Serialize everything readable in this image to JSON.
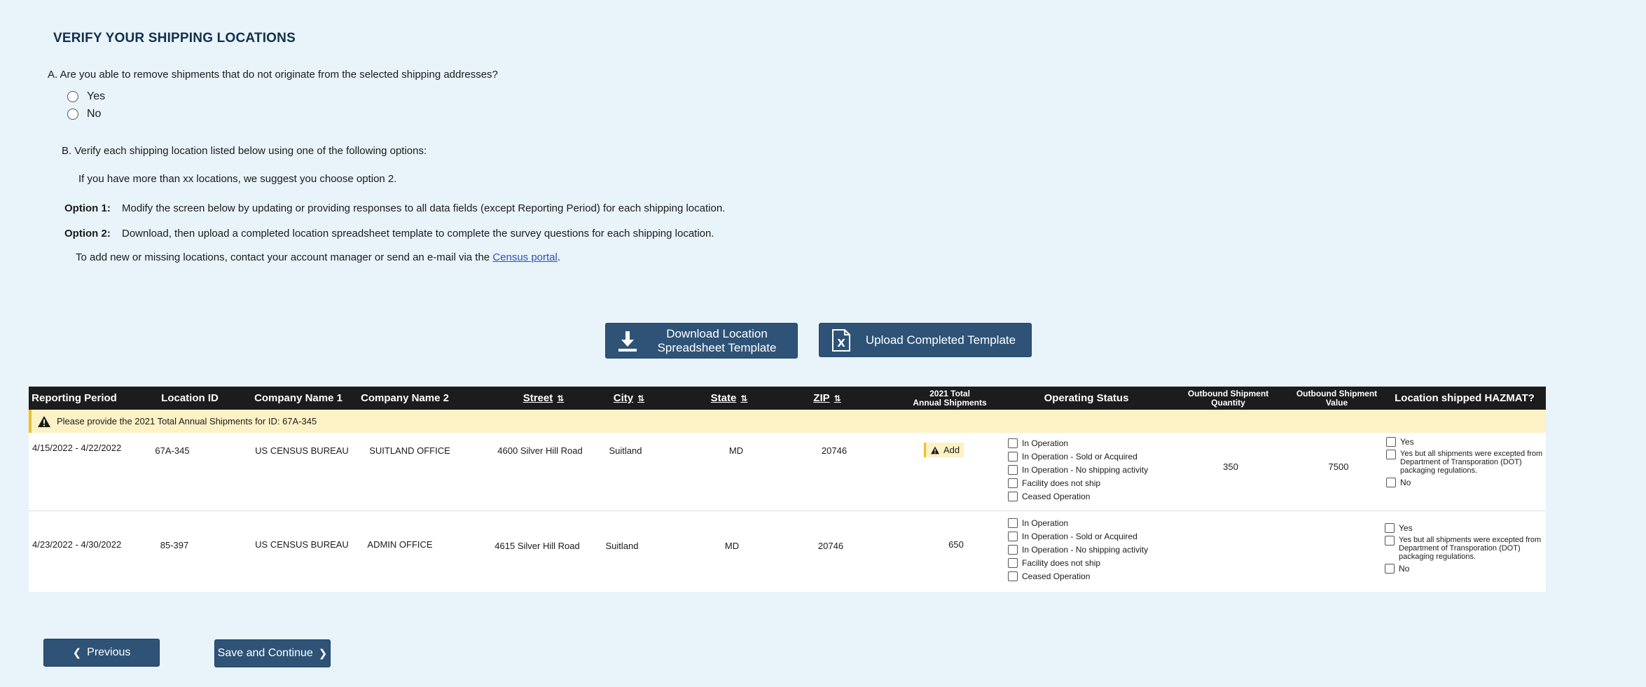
{
  "page": {
    "title": "VERIFY YOUR SHIPPING LOCATIONS"
  },
  "question_a": {
    "text": "A.  Are you able to remove shipments that do not originate from the selected shipping addresses?",
    "options": [
      "Yes",
      "No"
    ]
  },
  "question_b": {
    "text": "B.  Verify each shipping location listed below using one of the following options:",
    "hint": "If you have more than xx locations,  we suggest you choose option 2.",
    "option1_label": "Option 1:",
    "option1_text": "Modify the screen below by updating or providing responses to all data fields (except Reporting Period) for each shipping location.",
    "option2_label": "Option 2:",
    "option2_text": "Download, then upload a completed location spreadsheet template to complete the survey questions for each shipping location.",
    "add_missing_text": "To add new or missing locations,  contact your account manager or send an e-mail via the ",
    "census_link": "Census portal",
    "add_missing_end": "."
  },
  "buttons": {
    "download_line1": "Download Location",
    "download_line2": "Spreadsheet Template",
    "upload": "Upload Completed Template",
    "previous": "Previous",
    "save_continue": "Save and Continue"
  },
  "table": {
    "headers": {
      "reporting_period": "Reporting Period",
      "location_id": "Location ID",
      "company1": "Company Name 1",
      "company2": "Company Name 2",
      "street": "Street",
      "city": "City",
      "state": "State",
      "zip": "ZIP",
      "total_line1": "2021 Total",
      "total_line2": "Annual Shipments",
      "operating_status": "Operating Status",
      "qty_line1": "Outbound Shipment",
      "qty_line2": "Quantity",
      "value_line1": "Outbound Shipment",
      "value_line2": "Value",
      "hazmat": "Location shipped HAZMAT?"
    },
    "warning": "Please provide the 2021 Total Annual Shipments for ID:  67A-345",
    "status_options": [
      "In Operation",
      "In Operation - Sold or Acquired",
      "In Operation - No shipping activity",
      "Facility does not ship",
      "Ceased Operation"
    ],
    "hazmat_options": [
      "Yes",
      "Yes but all shipments were excepted from Department of Transporation (DOT) packaging regulations.",
      "No"
    ],
    "rows": [
      {
        "reporting_period": "4/15/2022 - 4/22/2022",
        "location_id": "67A-345",
        "company1": "US CENSUS BUREAU",
        "company2": "SUITLAND OFFICE",
        "street": "4600 Silver Hill Road",
        "city": "Suitland",
        "state": "MD",
        "zip": "20746",
        "total": "Add",
        "qty": "350",
        "value": "7500"
      },
      {
        "reporting_period": "4/23/2022 - 4/30/2022",
        "location_id": "85-397",
        "company1": "US CENSUS BUREAU",
        "company2": "ADMIN OFFICE",
        "street": "4615 Silver Hill Road",
        "city": "Suitland",
        "state": "MD",
        "zip": "20746",
        "total": "650",
        "qty": "",
        "value": ""
      }
    ]
  }
}
